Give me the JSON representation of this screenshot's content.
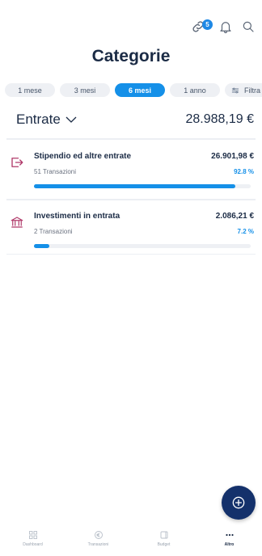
{
  "header": {
    "title": "Categorie",
    "notification_badge": "5"
  },
  "periods": [
    {
      "label": "1 mese",
      "active": false
    },
    {
      "label": "3 mesi",
      "active": false
    },
    {
      "label": "6 mesi",
      "active": true
    },
    {
      "label": "1 anno",
      "active": false
    }
  ],
  "filter_label": "Filtra",
  "section": {
    "title": "Entrate",
    "total": "28.988,19 €"
  },
  "categories": [
    {
      "name": "Stipendio ed altre entrate",
      "amount": "26.901,98 €",
      "transactions": "51 Transazioni",
      "percent": "92.8 %",
      "share": 0.928,
      "icon": "income-arrow-icon"
    },
    {
      "name": "Investimenti in entrata",
      "amount": "2.086,21 €",
      "transactions": "2 Transazioni",
      "percent": "7.2 %",
      "share": 0.072,
      "icon": "bank-icon"
    }
  ],
  "bottom_nav": [
    {
      "label": "Dashboard",
      "icon": "dashboard-icon",
      "active": false
    },
    {
      "label": "Transazioni",
      "icon": "euro-icon",
      "active": false
    },
    {
      "label": "Budget",
      "icon": "budget-icon",
      "active": false
    },
    {
      "label": "Altro",
      "icon": "more-icon",
      "active": true
    }
  ],
  "colors": {
    "accent": "#1590e8",
    "fab": "#14316b",
    "text": "#1b2b45",
    "chip_bg": "#eef0f4"
  }
}
